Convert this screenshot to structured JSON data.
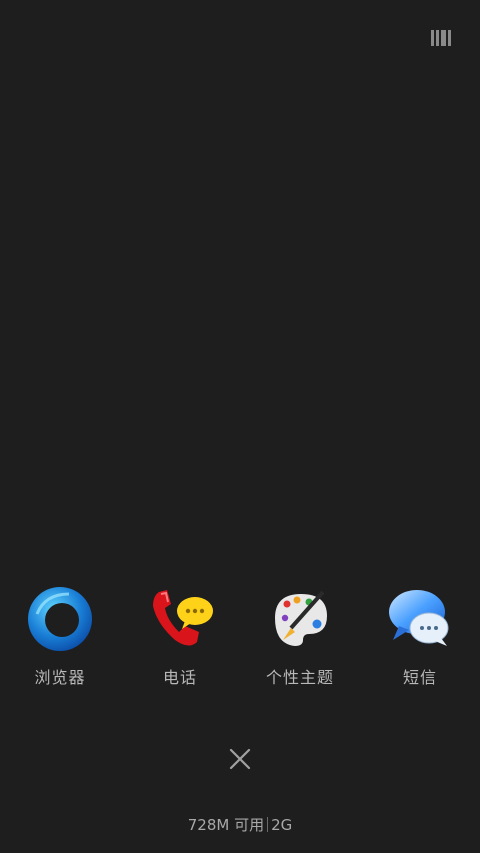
{
  "topbar": {
    "icon": "recent-tasks-grid-icon"
  },
  "apps": [
    {
      "label": "浏览器",
      "icon": "browser-icon"
    },
    {
      "label": "电话",
      "icon": "phone-icon"
    },
    {
      "label": "个性主题",
      "icon": "themes-palette-icon"
    },
    {
      "label": "短信",
      "icon": "messages-icon"
    }
  ],
  "close": {
    "icon": "close-icon"
  },
  "memory": {
    "available": "728M 可用",
    "total": "2G"
  }
}
